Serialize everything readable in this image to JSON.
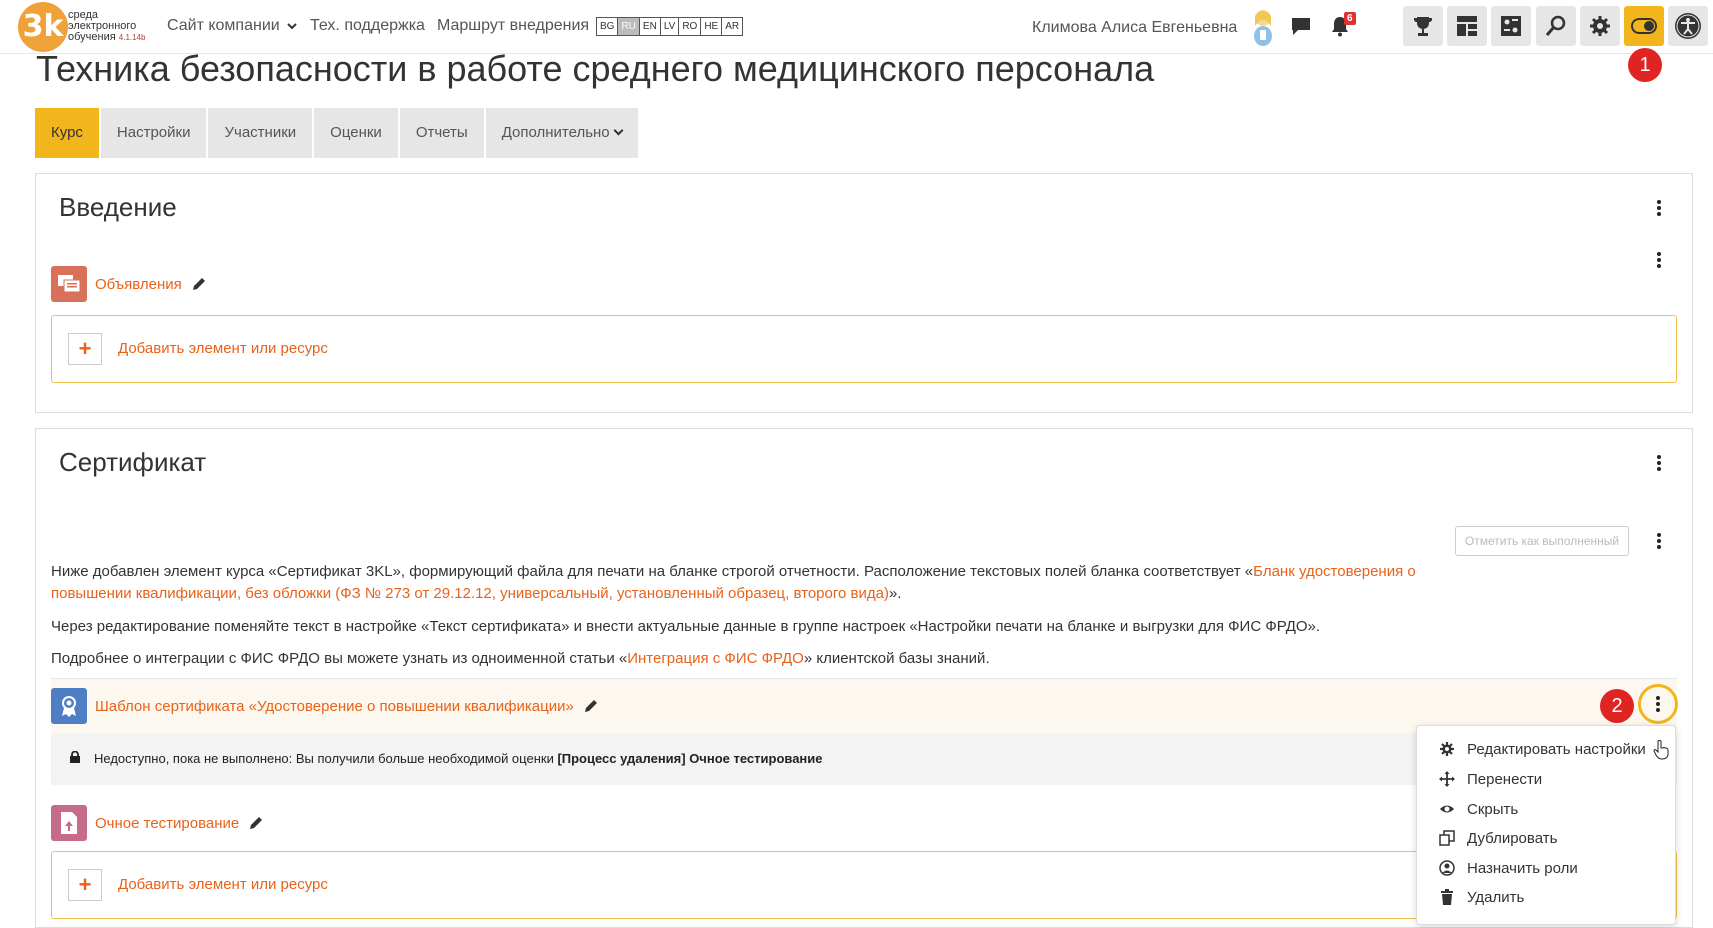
{
  "logo": {
    "mark": "3k",
    "line1": "среда",
    "line2": "электронного",
    "line3": "обучения",
    "version": "4.1.14b"
  },
  "nav": {
    "company": "Сайт компании",
    "support": "Тех. поддержка",
    "route": "Маршрут внедрения"
  },
  "languages": [
    {
      "code": "BG",
      "active": false
    },
    {
      "code": "RU",
      "active": true
    },
    {
      "code": "EN",
      "active": false
    },
    {
      "code": "LV",
      "active": false
    },
    {
      "code": "RO",
      "active": false
    },
    {
      "code": "HE",
      "active": false
    },
    {
      "code": "AR",
      "active": false
    }
  ],
  "user": {
    "name": "Климова Алиса Евгеньевна"
  },
  "notifications": {
    "count": "6"
  },
  "markers": {
    "first": "1",
    "second": "2"
  },
  "page": {
    "title": "Техника безопасности в работе среднего медицинского персонала"
  },
  "tabs": [
    "Курс",
    "Настройки",
    "Участники",
    "Оценки",
    "Отчеты",
    "Дополнительно"
  ],
  "sections": {
    "intro": {
      "title": "Введение",
      "announcements": "Объявления",
      "add_resource": "Добавить элемент или ресурс"
    },
    "certificate": {
      "title": "Сертификат",
      "mark_done": "Отметить как выполненный",
      "para1_a": "Ниже добавлен элемент курса «Сертификат 3KL», формирующий файла для печати на бланке строгой отчетности. Расположение текстовых полей бланка соответствует  «",
      "para1_link": "Бланк удостоверения о повышении квалификации, без обложки (ФЗ № 273 от 29.12.12, универсальный, установленный образец, второго вида)",
      "para1_b": "».",
      "para2": "Через редактирование поменяйте текст в настройке «Текст сертификата» и внести актуальные данные в группе настроек «Настройки печати на бланке и выгрузки для ФИС ФРДО».",
      "para3_a": "Подробнее о интеграции с ФИС ФРДО вы можете узнать из одноименной статьи «",
      "para3_link": "Интеграция с ФИС ФРДО",
      "para3_b": "» клиентской базы знаний.",
      "cert_template": "Шаблон сертификата «Удостоверение о повышении квалификации»",
      "restriction_text": "Недоступно, пока не выполнено: Вы получили больше необходимой оценки ",
      "restriction_bold": "[Процесс удаления] Очное тестирование",
      "test": "Очное тестирование",
      "add_resource": "Добавить элемент или ресурс"
    }
  },
  "dropdown": {
    "items": [
      "Редактировать настройки",
      "Перенести",
      "Скрыть",
      "Дублировать",
      "Назначить роли",
      "Удалить"
    ]
  },
  "colors": {
    "accent": "#f3b51c",
    "link": "#e8621a",
    "marker": "#e02424"
  }
}
